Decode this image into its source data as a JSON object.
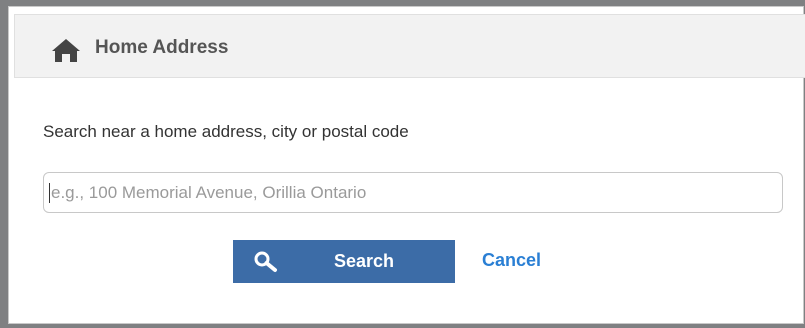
{
  "dialog": {
    "title": "Home Address",
    "title_icon": "home-icon",
    "prompt": "Search near a home address, city or postal code",
    "search": {
      "value": "",
      "placeholder": "e.g., 100 Memorial Avenue, Orillia Ontario"
    },
    "search_button": {
      "label": "Search",
      "icon": "search-icon"
    },
    "cancel_label": "Cancel"
  },
  "colors": {
    "header_bg": "#f2f2f2",
    "button_bg": "#3c6ca7",
    "link": "#2a7fd4"
  }
}
